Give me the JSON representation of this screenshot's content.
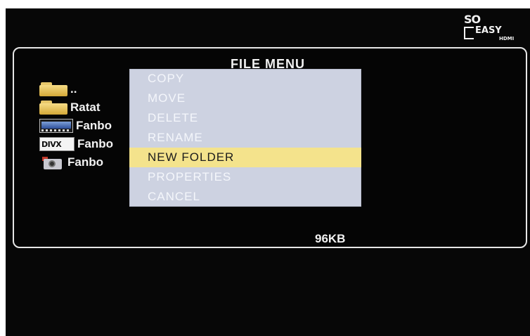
{
  "logo": {
    "line1": "SO",
    "line2": "EASY",
    "line3": "HDMI"
  },
  "panel": {
    "title": "FILE MENU",
    "size": "96KB"
  },
  "files": [
    {
      "icon": "folder-icon",
      "name": ".."
    },
    {
      "icon": "folder-icon",
      "name": "Ratat"
    },
    {
      "icon": "video-file-icon",
      "name": "Fanbo"
    },
    {
      "icon": "divx-file-icon",
      "name": "Fanbo",
      "icon_text": "DIVX"
    },
    {
      "icon": "photo-file-icon",
      "name": "Fanbo"
    }
  ],
  "menu": {
    "items": [
      {
        "label": "COPY"
      },
      {
        "label": "MOVE"
      },
      {
        "label": "DELETE"
      },
      {
        "label": "RENAME"
      },
      {
        "label": "NEW FOLDER"
      },
      {
        "label": "PROPERTIES"
      },
      {
        "label": "CANCEL"
      }
    ],
    "selected": "NEW FOLDER",
    "highlight_color": "#f4e38c",
    "background_color": "#cdd2e1"
  }
}
